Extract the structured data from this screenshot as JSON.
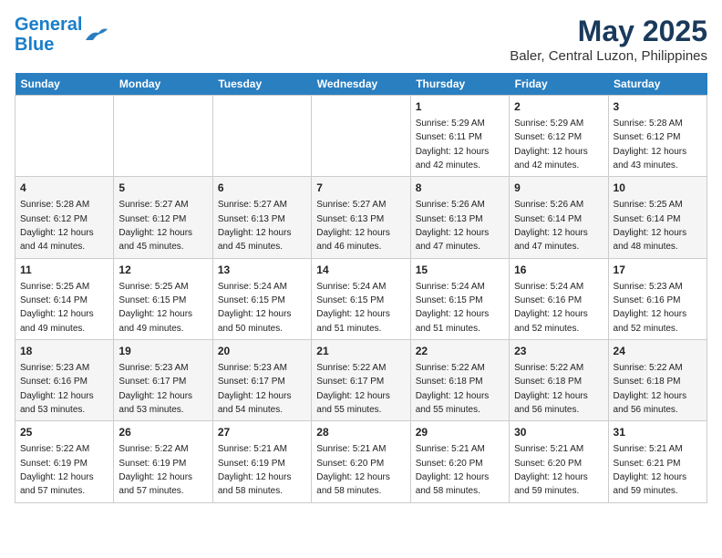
{
  "header": {
    "logo_line1": "General",
    "logo_line2": "Blue",
    "title": "May 2025",
    "subtitle": "Baler, Central Luzon, Philippines"
  },
  "days_of_week": [
    "Sunday",
    "Monday",
    "Tuesday",
    "Wednesday",
    "Thursday",
    "Friday",
    "Saturday"
  ],
  "weeks": [
    [
      {
        "day": "",
        "info": ""
      },
      {
        "day": "",
        "info": ""
      },
      {
        "day": "",
        "info": ""
      },
      {
        "day": "",
        "info": ""
      },
      {
        "day": "1",
        "info": "Sunrise: 5:29 AM\nSunset: 6:11 PM\nDaylight: 12 hours\nand 42 minutes."
      },
      {
        "day": "2",
        "info": "Sunrise: 5:29 AM\nSunset: 6:12 PM\nDaylight: 12 hours\nand 42 minutes."
      },
      {
        "day": "3",
        "info": "Sunrise: 5:28 AM\nSunset: 6:12 PM\nDaylight: 12 hours\nand 43 minutes."
      }
    ],
    [
      {
        "day": "4",
        "info": "Sunrise: 5:28 AM\nSunset: 6:12 PM\nDaylight: 12 hours\nand 44 minutes."
      },
      {
        "day": "5",
        "info": "Sunrise: 5:27 AM\nSunset: 6:12 PM\nDaylight: 12 hours\nand 45 minutes."
      },
      {
        "day": "6",
        "info": "Sunrise: 5:27 AM\nSunset: 6:13 PM\nDaylight: 12 hours\nand 45 minutes."
      },
      {
        "day": "7",
        "info": "Sunrise: 5:27 AM\nSunset: 6:13 PM\nDaylight: 12 hours\nand 46 minutes."
      },
      {
        "day": "8",
        "info": "Sunrise: 5:26 AM\nSunset: 6:13 PM\nDaylight: 12 hours\nand 47 minutes."
      },
      {
        "day": "9",
        "info": "Sunrise: 5:26 AM\nSunset: 6:14 PM\nDaylight: 12 hours\nand 47 minutes."
      },
      {
        "day": "10",
        "info": "Sunrise: 5:25 AM\nSunset: 6:14 PM\nDaylight: 12 hours\nand 48 minutes."
      }
    ],
    [
      {
        "day": "11",
        "info": "Sunrise: 5:25 AM\nSunset: 6:14 PM\nDaylight: 12 hours\nand 49 minutes."
      },
      {
        "day": "12",
        "info": "Sunrise: 5:25 AM\nSunset: 6:15 PM\nDaylight: 12 hours\nand 49 minutes."
      },
      {
        "day": "13",
        "info": "Sunrise: 5:24 AM\nSunset: 6:15 PM\nDaylight: 12 hours\nand 50 minutes."
      },
      {
        "day": "14",
        "info": "Sunrise: 5:24 AM\nSunset: 6:15 PM\nDaylight: 12 hours\nand 51 minutes."
      },
      {
        "day": "15",
        "info": "Sunrise: 5:24 AM\nSunset: 6:15 PM\nDaylight: 12 hours\nand 51 minutes."
      },
      {
        "day": "16",
        "info": "Sunrise: 5:24 AM\nSunset: 6:16 PM\nDaylight: 12 hours\nand 52 minutes."
      },
      {
        "day": "17",
        "info": "Sunrise: 5:23 AM\nSunset: 6:16 PM\nDaylight: 12 hours\nand 52 minutes."
      }
    ],
    [
      {
        "day": "18",
        "info": "Sunrise: 5:23 AM\nSunset: 6:16 PM\nDaylight: 12 hours\nand 53 minutes."
      },
      {
        "day": "19",
        "info": "Sunrise: 5:23 AM\nSunset: 6:17 PM\nDaylight: 12 hours\nand 53 minutes."
      },
      {
        "day": "20",
        "info": "Sunrise: 5:23 AM\nSunset: 6:17 PM\nDaylight: 12 hours\nand 54 minutes."
      },
      {
        "day": "21",
        "info": "Sunrise: 5:22 AM\nSunset: 6:17 PM\nDaylight: 12 hours\nand 55 minutes."
      },
      {
        "day": "22",
        "info": "Sunrise: 5:22 AM\nSunset: 6:18 PM\nDaylight: 12 hours\nand 55 minutes."
      },
      {
        "day": "23",
        "info": "Sunrise: 5:22 AM\nSunset: 6:18 PM\nDaylight: 12 hours\nand 56 minutes."
      },
      {
        "day": "24",
        "info": "Sunrise: 5:22 AM\nSunset: 6:18 PM\nDaylight: 12 hours\nand 56 minutes."
      }
    ],
    [
      {
        "day": "25",
        "info": "Sunrise: 5:22 AM\nSunset: 6:19 PM\nDaylight: 12 hours\nand 57 minutes."
      },
      {
        "day": "26",
        "info": "Sunrise: 5:22 AM\nSunset: 6:19 PM\nDaylight: 12 hours\nand 57 minutes."
      },
      {
        "day": "27",
        "info": "Sunrise: 5:21 AM\nSunset: 6:19 PM\nDaylight: 12 hours\nand 58 minutes."
      },
      {
        "day": "28",
        "info": "Sunrise: 5:21 AM\nSunset: 6:20 PM\nDaylight: 12 hours\nand 58 minutes."
      },
      {
        "day": "29",
        "info": "Sunrise: 5:21 AM\nSunset: 6:20 PM\nDaylight: 12 hours\nand 58 minutes."
      },
      {
        "day": "30",
        "info": "Sunrise: 5:21 AM\nSunset: 6:20 PM\nDaylight: 12 hours\nand 59 minutes."
      },
      {
        "day": "31",
        "info": "Sunrise: 5:21 AM\nSunset: 6:21 PM\nDaylight: 12 hours\nand 59 minutes."
      }
    ]
  ]
}
